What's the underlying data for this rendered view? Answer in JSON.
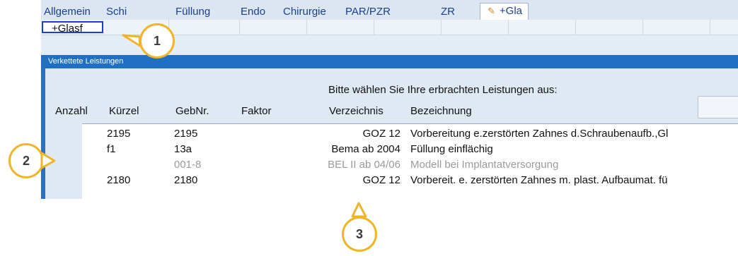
{
  "tabs": [
    "Allgemein",
    "Schi",
    "Füllung",
    "Endo",
    "Chirurgie",
    "PAR/PZR",
    "ZR",
    "+Gla"
  ],
  "subbar": {
    "button_label": "+Glasf"
  },
  "dialog": {
    "title": "Verkettete Leistungen",
    "prompt": "Bitte wählen Sie Ihre erbrachten Leistungen aus:",
    "columns": {
      "anzahl": "Anzahl",
      "kuerzel": "Kürzel",
      "gebnr": "GebNr.",
      "faktor": "Faktor",
      "verzeichnis": "Verzeichnis",
      "bezeichnung": "Bezeichnung"
    }
  },
  "rows": [
    {
      "kuerzel": "2195",
      "gebnr": "2195",
      "verzeichnis": "GOZ 12",
      "bezeichnung": "Vorbereitung e.zerstörten Zahnes d.Schraubenaufb.,Gl",
      "dim": false
    },
    {
      "kuerzel": "f1",
      "gebnr": "13a",
      "verzeichnis": "Bema ab 2004",
      "bezeichnung": "Füllung einflächig",
      "dim": false
    },
    {
      "kuerzel": "",
      "gebnr": "001-8",
      "verzeichnis": "BEL II ab 04/06",
      "bezeichnung": "Modell bei Implantatversorgung",
      "dim": true
    },
    {
      "kuerzel": "2180",
      "gebnr": "2180",
      "verzeichnis": "GOZ 12",
      "bezeichnung": "Vorbereit. e. zerstörten Zahnes m. plast. Aufbaumat. fü",
      "dim": false
    }
  ],
  "callouts": [
    "1",
    "2",
    "3"
  ],
  "colors": {
    "callout_border": "#f0b429",
    "title_bar": "#1f6fc4",
    "focus_border": "#1f3bd6"
  }
}
